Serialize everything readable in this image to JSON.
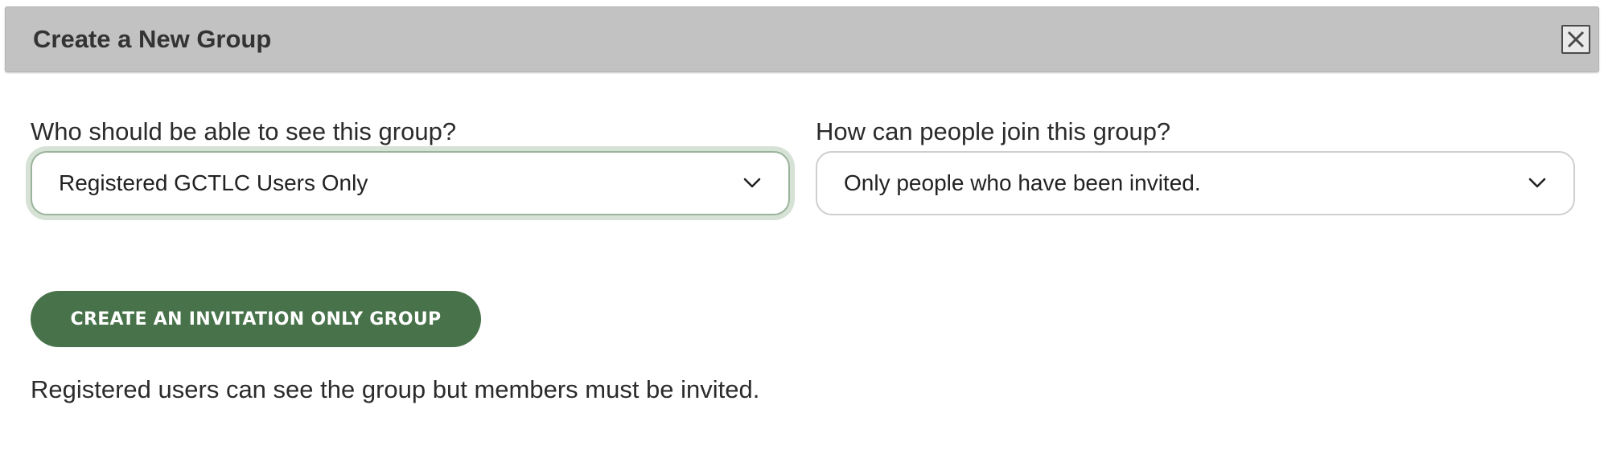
{
  "dialog": {
    "title": "Create a New Group",
    "close_icon": "close-icon"
  },
  "visibility": {
    "label": "Who should be able to see this group?",
    "selected": "Registered GCTLC Users Only",
    "icon": "chevron-down-icon"
  },
  "join": {
    "label": "How can people join this group?",
    "selected": "Only people who have been invited.",
    "icon": "chevron-down-icon"
  },
  "action": {
    "button_label": "CREATE AN INVITATION ONLY GROUP"
  },
  "help": {
    "text": "Registered users can see the group but members must be invited."
  },
  "colors": {
    "primary_button": "#48734a",
    "title_bar": "#c2c2c2",
    "focus_ring": "#d6e2d6"
  }
}
